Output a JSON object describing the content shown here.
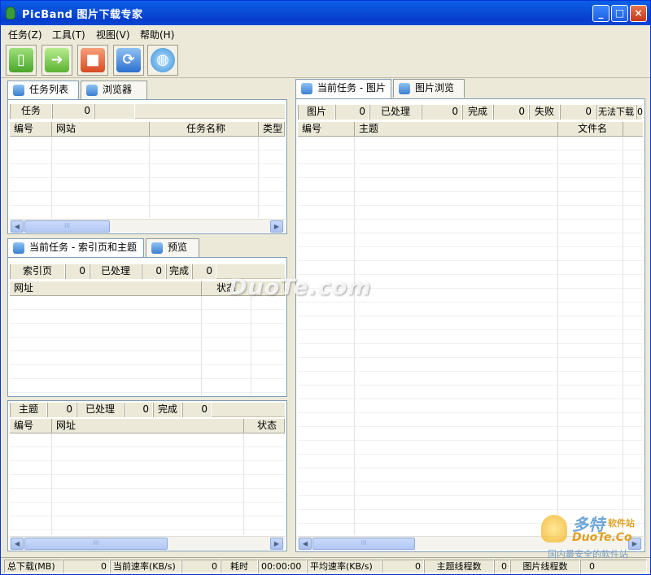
{
  "window": {
    "title": "PicBand 图片下载专家",
    "controls": [
      "_",
      "□",
      "×"
    ]
  },
  "menu": [
    "任务(Z)",
    "工具(T)",
    "视图(V)",
    "帮助(H)"
  ],
  "toolbar": {
    "buttons": [
      {
        "icon": "new-task-icon",
        "color": "#5fb83a"
      },
      {
        "icon": "start-icon",
        "color": "#7ac84a"
      },
      {
        "icon": "stop-icon",
        "color": "#e8613b"
      },
      {
        "icon": "refresh-icon",
        "color": "#3c82d8"
      },
      {
        "icon": "globe-icon",
        "color": "#4aa0e0"
      }
    ]
  },
  "left_top": {
    "tabs": [
      "任务列表",
      "浏览器"
    ],
    "stats": {
      "label": "任务",
      "value": "0"
    },
    "columns": [
      "编号",
      "网站",
      "任务名称",
      "类型"
    ]
  },
  "left_mid": {
    "tabs": [
      "当前任务 - 索引页和主题",
      "预览"
    ],
    "stats": [
      {
        "label": "索引页",
        "value": "0"
      },
      {
        "label": "已处理",
        "value": "0"
      },
      {
        "label": "完成",
        "value": "0"
      }
    ],
    "columns": [
      "网址",
      "状态"
    ]
  },
  "left_bottom": {
    "stats": [
      {
        "label": "主题",
        "value": "0"
      },
      {
        "label": "已处理",
        "value": "0"
      },
      {
        "label": "完成",
        "value": "0"
      }
    ],
    "columns": [
      "编号",
      "网址",
      "状态"
    ]
  },
  "right": {
    "tabs": [
      "当前任务 - 图片",
      "图片浏览"
    ],
    "stats": [
      {
        "label": "图片",
        "value": "0"
      },
      {
        "label": "已处理",
        "value": "0"
      },
      {
        "label": "完成",
        "value": "0"
      },
      {
        "label": "失败",
        "value": "0"
      },
      {
        "label": "无法下载",
        "value": "0"
      }
    ],
    "columns": [
      "编号",
      "主题",
      "文件名"
    ]
  },
  "statusbar": [
    {
      "label": "总下载(MB)",
      "value": "0"
    },
    {
      "label": "当前速率(KB/s)",
      "value": "0"
    },
    {
      "label": "耗时",
      "value": "00:00:00"
    },
    {
      "label": "平均速率(KB/s)",
      "value": "0"
    },
    {
      "label": "主题线程数",
      "value": "0"
    },
    {
      "label": "图片线程数",
      "value": "0"
    }
  ],
  "watermark": {
    "center": "DuoTe.com",
    "logo_cn": "多特",
    "logo_sub": "软件站",
    "logo_en": "DuoTe.Co",
    "logo_tag": "国内最安全的软件站"
  },
  "scroll_grip": "III"
}
